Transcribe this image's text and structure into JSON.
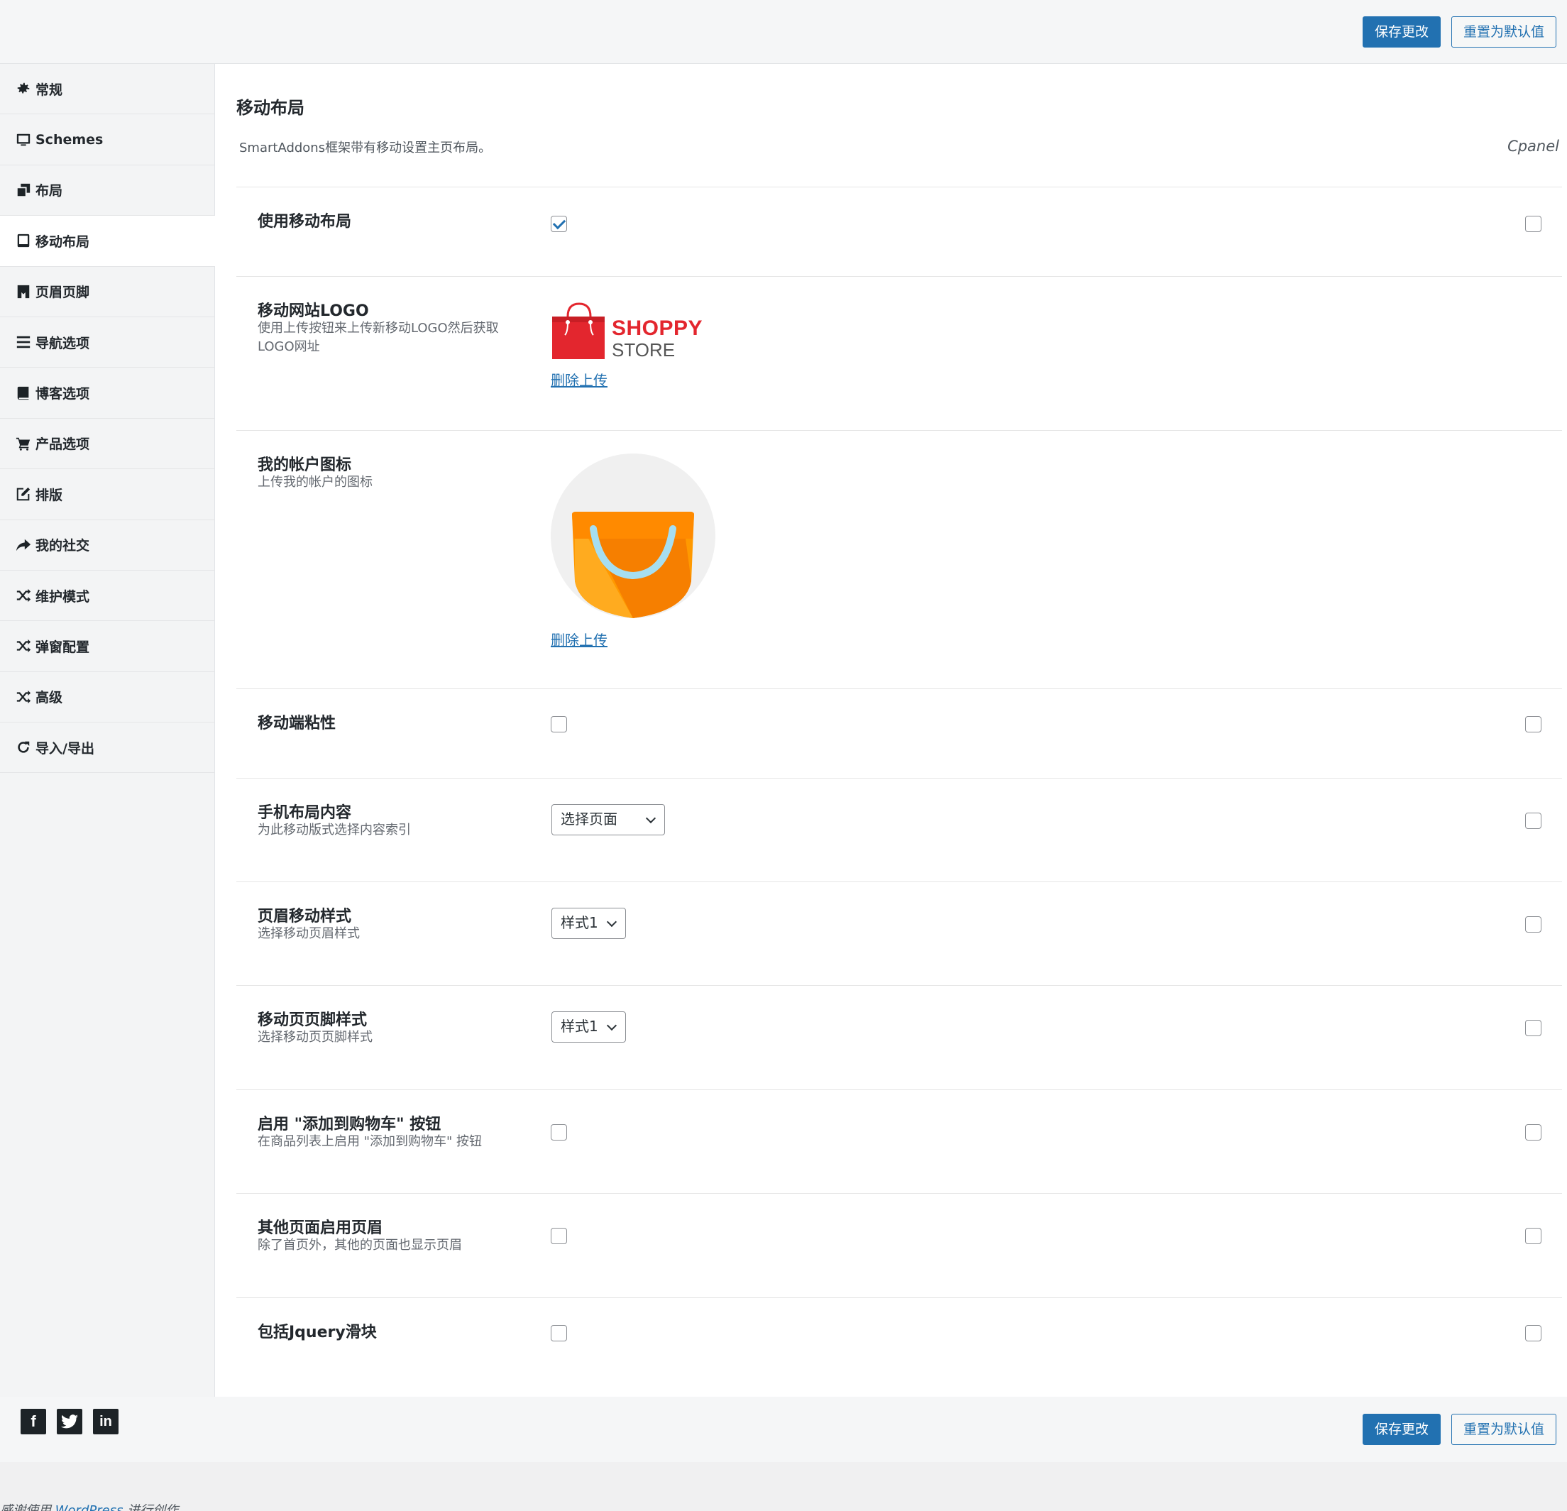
{
  "toolbar": {
    "save_label": "保存更改",
    "reset_label": "重置为默认值"
  },
  "sidebar": {
    "items": [
      {
        "label": "常规",
        "icon": "gear-icon"
      },
      {
        "label": "Schemes",
        "icon": "monitor-icon"
      },
      {
        "label": "布局",
        "icon": "copy-icon"
      },
      {
        "label": "移动布局",
        "icon": "tablet-icon"
      },
      {
        "label": "页眉页脚",
        "icon": "bookmark-icon"
      },
      {
        "label": "导航选项",
        "icon": "bars-icon"
      },
      {
        "label": "博客选项",
        "icon": "book-icon"
      },
      {
        "label": "产品选项",
        "icon": "cart-icon"
      },
      {
        "label": "排版",
        "icon": "edit-icon"
      },
      {
        "label": "我的社交",
        "icon": "share-icon"
      },
      {
        "label": "维护模式",
        "icon": "shuffle-icon"
      },
      {
        "label": "弹窗配置",
        "icon": "shuffle-icon"
      },
      {
        "label": "高级",
        "icon": "shuffle-icon"
      },
      {
        "label": "导入/导出",
        "icon": "refresh-icon"
      }
    ]
  },
  "section": {
    "title": "移动布局",
    "description": "SmartAddons框架带有移动设置主页布局。",
    "cpanel": "Cpanel"
  },
  "fields": {
    "use_mobile": {
      "label": "使用移动布局"
    },
    "mobile_logo": {
      "label": "移动网站LOGO",
      "desc": "使用上传按钮来上传新移动LOGO然后获取LOGO网址",
      "logo_text_1": "SHOPPY",
      "logo_text_2": "STORE",
      "remove": "删除上传"
    },
    "account_icon": {
      "label": "我的帐户图标",
      "desc": "上传我的帐户的图标",
      "remove": "删除上传"
    },
    "sticky": {
      "label": "移动端粘性"
    },
    "layout_content": {
      "label": "手机布局内容",
      "desc": "为此移动版式选择内容索引",
      "value": "选择页面"
    },
    "header_style": {
      "label": "页眉移动样式",
      "desc": "选择移动页眉样式",
      "value": "样式1"
    },
    "footer_style": {
      "label": "移动页页脚样式",
      "desc": "选择移动页页脚样式",
      "value": "样式1"
    },
    "add_to_cart": {
      "label": "启用 \"添加到购物车\" 按钮",
      "desc": "在商品列表上启用 \"添加到购物车\" 按钮"
    },
    "other_header": {
      "label": "其他页面启用页眉",
      "desc": "除了首页外，其他的页面也显示页眉"
    },
    "jquery_slider": {
      "label": "包括Jquery滑块"
    }
  },
  "footer": {
    "social": [
      "facebook-icon",
      "twitter-icon",
      "linkedin-icon"
    ],
    "credits_prefix": "感谢使用",
    "credits_link": "WordPress",
    "credits_suffix": "进行创作。"
  },
  "colors": {
    "accent": "#2271b1",
    "logo_red": "#e3262e",
    "bag_orange": "#ff8a00"
  }
}
